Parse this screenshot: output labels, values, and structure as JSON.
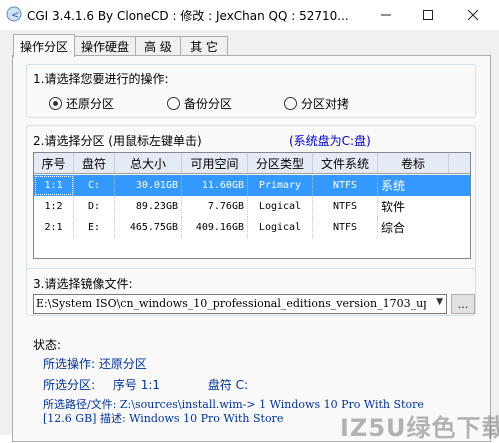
{
  "window": {
    "title": "CGI 3.4.1.6 By CloneCD : 修改 : JexChan  QQ : 52710...",
    "chevron": "<"
  },
  "tabs": [
    {
      "label": "操作分区",
      "active": true
    },
    {
      "label": "操作硬盘",
      "active": false
    },
    {
      "label": "高 级",
      "active": false
    },
    {
      "label": "其 它",
      "active": false
    }
  ],
  "operation": {
    "title": "1.请选择您要进行的操作:",
    "options": [
      {
        "label": "还原分区",
        "selected": true
      },
      {
        "label": "备份分区",
        "selected": false
      },
      {
        "label": "分区对拷",
        "selected": false
      }
    ]
  },
  "partition": {
    "title": "2.请选择分区 (用鼠标左键单击)",
    "system_note": "(系统盘为C:盘)",
    "columns": [
      "序号",
      "盘符",
      "总大小",
      "可用空间",
      "分区类型",
      "文件系统",
      "卷标"
    ],
    "rows": [
      {
        "id": "1:1",
        "drive": "C:",
        "size": "30.01GB",
        "free": "11.60GB",
        "type": "Primary",
        "fs": "NTFS",
        "label": "系统",
        "selected": true
      },
      {
        "id": "1:2",
        "drive": "D:",
        "size": "89.23GB",
        "free": "7.76GB",
        "type": "Logical",
        "fs": "NTFS",
        "label": "软件",
        "selected": false
      },
      {
        "id": "2:1",
        "drive": "E:",
        "size": "465.75GB",
        "free": "409.16GB",
        "type": "Logical",
        "fs": "NTFS",
        "label": "综合",
        "selected": false
      }
    ]
  },
  "image_file": {
    "title": "3.请选择镜像文件:",
    "value": "E:\\System ISO\\cn_windows_10_professional_editions_version_1703_up",
    "browse_label": "..."
  },
  "status": {
    "title": "状态:",
    "operation_line": "所选操作: 还原分区",
    "partition_prefix": "所选分区:",
    "partition_no": "序号 1:1",
    "partition_drive": "盘符 C:",
    "path_line": "所选路径/文件: Z:\\sources\\install.wim-> 1  Windows 10 Pro With Store",
    "desc_line": "[12.6 GB]  描述: Windows 10 Pro With Store"
  },
  "watermark": "IZ5U绿色下载",
  "colors": {
    "selection": "#3399ff",
    "status_text": "#003399",
    "system_note": "#0000cc"
  }
}
